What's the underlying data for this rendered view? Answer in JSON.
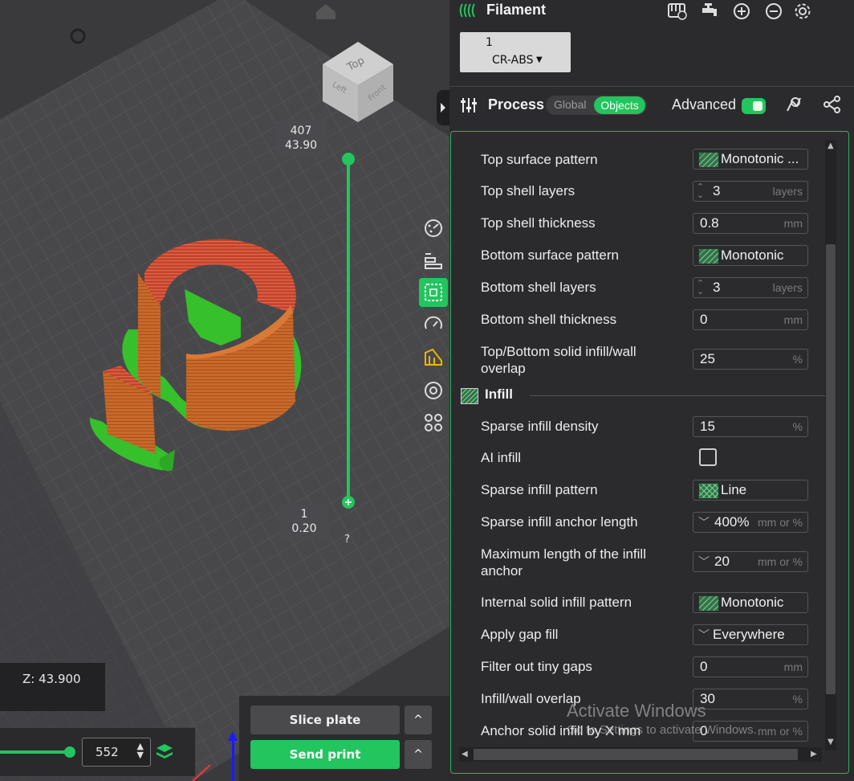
{
  "viewport": {
    "nav_cube": {
      "top": "Top",
      "left": "Left",
      "front": "Front"
    },
    "layer_top": {
      "layer": "407",
      "height": "43.90"
    },
    "layer_bottom": {
      "layer": "1",
      "height": "0.20"
    },
    "help": "?",
    "z_readout": "Z: 43.900",
    "layer_value": "552",
    "slice_label": "Slice plate",
    "send_label": "Send print",
    "caret": "^",
    "side_tools": [
      "dashboard-icon",
      "arrange-icon",
      "layer-view-icon",
      "speed-icon",
      "support-icon",
      "measure-icon",
      "assembly-icon"
    ]
  },
  "filament": {
    "title": "Filament",
    "slot_number": "1",
    "slot_name": "CR-ABS",
    "icons": [
      "ams-icon",
      "tap-icon",
      "add-icon",
      "remove-icon",
      "settings-icon"
    ]
  },
  "process": {
    "title": "Process",
    "global_label": "Global",
    "objects_label": "Objects",
    "advanced_label": "Advanced",
    "advanced_on": true
  },
  "settings": {
    "rows_top": [
      {
        "label": "Top surface pattern",
        "kind": "pattern",
        "value": "Monotonic ..."
      },
      {
        "label": "Top shell layers",
        "kind": "spin",
        "value": "3",
        "unit": "layers"
      },
      {
        "label": "Top shell thickness",
        "kind": "text",
        "value": "0.8",
        "unit": "mm"
      },
      {
        "label": "Bottom surface pattern",
        "kind": "pattern",
        "value": "Monotonic"
      },
      {
        "label": "Bottom shell layers",
        "kind": "spin",
        "value": "3",
        "unit": "layers"
      },
      {
        "label": "Bottom shell thickness",
        "kind": "text",
        "value": "0",
        "unit": "mm"
      },
      {
        "label": "Top/Bottom solid infill/wall overlap",
        "kind": "text",
        "value": "25",
        "unit": "%"
      }
    ],
    "infill_section": "Infill",
    "rows_infill": [
      {
        "label": "Sparse infill density",
        "kind": "text",
        "value": "15",
        "unit": "%"
      },
      {
        "label": "AI infill",
        "kind": "checkbox",
        "checked": false
      },
      {
        "label": "Sparse infill pattern",
        "kind": "pattern-cross",
        "value": "Line"
      },
      {
        "label": "Sparse infill anchor length",
        "kind": "combo",
        "value": "400%",
        "unit": "mm or %"
      },
      {
        "label": "Maximum length of the infill anchor",
        "kind": "combo",
        "value": "20",
        "unit": "mm or %"
      },
      {
        "label": "Internal solid infill pattern",
        "kind": "pattern",
        "value": "Monotonic"
      },
      {
        "label": "Apply gap fill",
        "kind": "combo",
        "value": "Everywhere"
      },
      {
        "label": "Filter out tiny gaps",
        "kind": "text",
        "value": "0",
        "unit": "mm"
      },
      {
        "label": "Infill/wall overlap",
        "kind": "text",
        "value": "30",
        "unit": "%"
      },
      {
        "label": "Anchor solid infill by X mm",
        "kind": "text",
        "value": "0",
        "unit": "mm or %"
      }
    ]
  },
  "watermark": {
    "line1": "Activate Windows",
    "line2": "Go to Settings to activate Windows."
  },
  "colors": {
    "accent": "#22c55e",
    "model_orange": "#c8692a",
    "model_red": "#c4432e",
    "support_green": "#35c02c",
    "bed": "#48484b"
  }
}
